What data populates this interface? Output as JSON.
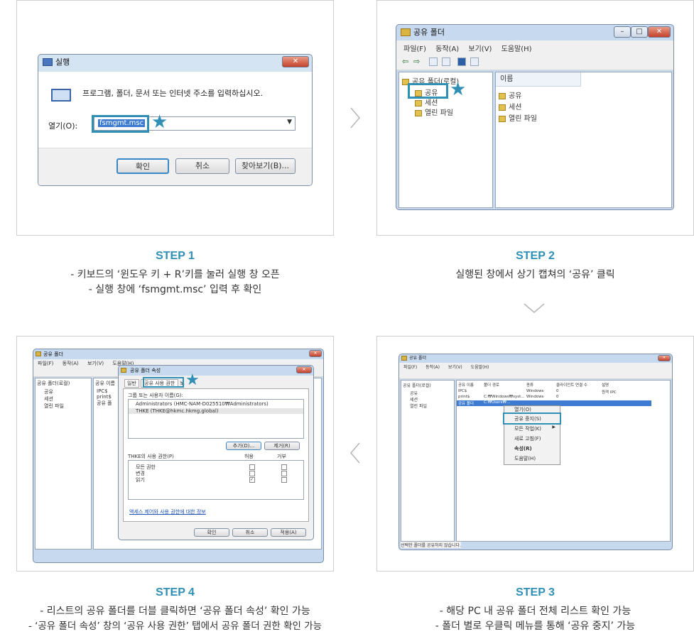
{
  "steps": [
    {
      "title": "STEP 1",
      "lines": [
        "- 키보드의 ‘윈도우 키 + R’키를 눌러 실행 창 오픈",
        "- 실행 창에 ‘fsmgmt.msc’ 입력 후 확인"
      ]
    },
    {
      "title": "STEP 2",
      "lines": [
        "실행된 창에서 상기 캡쳐의 ‘공유’ 클릭"
      ]
    },
    {
      "title": "STEP 3",
      "lines": [
        "- 해당 PC 내 공유 폴더 전체 리스트 확인 가능",
        "- 폴더 별로 우클릭 메뉴를 통해 ‘공유 중지’ 가능"
      ]
    },
    {
      "title": "STEP 4",
      "lines": [
        "- 리스트의 공유 폴더를 더블 클릭하면 ‘공유 폴더 속성’ 확인 가능",
        "- ‘공유 폴더 속성’ 창의 ‘공유 사용 권한’ 탭에서 공유 폴더 권한 확인 가능"
      ]
    }
  ],
  "run_dialog": {
    "title": "실행",
    "prompt": "프로그램, 폴더, 문서 또는 인터넷 주소를 입력하십시오.",
    "open_label": "열기(O):",
    "input_value": "fsmgmt.msc",
    "ok": "확인",
    "cancel": "취소",
    "browse": "찾아보기(B)..."
  },
  "shared_folders": {
    "title": "공유 폴더",
    "menu": [
      "파일(F)",
      "동작(A)",
      "보기(V)",
      "도움말(H)"
    ],
    "tree_root": "공유 폴더(로컬)",
    "tree_items": [
      "공유",
      "세션",
      "열린 파일"
    ],
    "list_header": "이름",
    "list_items": [
      "공유",
      "세션",
      "열린 파일"
    ]
  },
  "step3": {
    "title": "공유 폴더",
    "menu": [
      "파일(F)",
      "동작(A)",
      "보기(V)",
      "도움말(H)"
    ],
    "tree_root": "공유 폴더(로컬)",
    "tree_items": [
      "공유",
      "세션",
      "열린 파일"
    ],
    "columns": [
      "공유 이름",
      "폴더 경로",
      "종류",
      "클라이언트 연결 수",
      "설명"
    ],
    "rows": [
      [
        "IPC$",
        "",
        "Windows",
        "0",
        "원격 IPC"
      ],
      [
        "print$",
        "C:₩Windows₩syst...",
        "Windows",
        "0",
        ""
      ],
      [
        "공유 폴더",
        "C:₩Users₩...",
        "",
        "",
        ""
      ]
    ],
    "context_menu": [
      "열기(O)",
      "공유 중지(S)",
      "모든 작업(K)",
      "새로 고침(F)",
      "속성(R)",
      "도움말(H)"
    ],
    "status": "선택한 폴더를 공유하지 않습니다."
  },
  "step4": {
    "title": "공유 폴더",
    "menu": [
      "파일(F)",
      "동작(A)",
      "보기(V)",
      "도움말(H)"
    ],
    "tree_root": "공유 폴더(로컬)",
    "tree_items": [
      "공유",
      "세션",
      "열린 파일"
    ],
    "share_col": "공유 이름",
    "shares": [
      "IPC$",
      "print$",
      "공유 폴"
    ],
    "dialog_title": "공유 폴더 속성",
    "tabs": [
      "일반",
      "공유 사용 권한",
      "보"
    ],
    "group_label": "그룹 또는 사용자 이름(G):",
    "users": [
      "Administrators (HMC-NAM-D025510₩Administrators)",
      "THKE (THKE@hkmc.hkmg.global)"
    ],
    "add": "추가(D)...",
    "remove": "제거(R)",
    "perm_label": "THKE의 사용 권한(P)",
    "allow": "허용",
    "deny": "거부",
    "perms": [
      "모든 권한",
      "변경",
      "읽기"
    ],
    "link": "액세스 제어와 사용 권한에 대한 정보",
    "ok": "확인",
    "cancel": "취소",
    "apply": "적용(A)"
  }
}
